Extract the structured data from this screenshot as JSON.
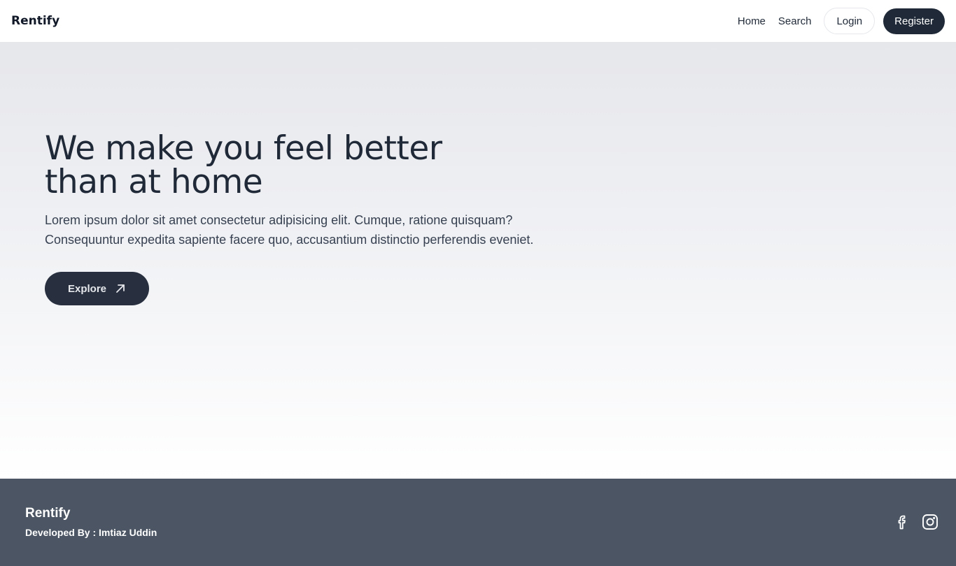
{
  "nav": {
    "brand": "Rentify",
    "links": [
      "Home",
      "Search"
    ],
    "login_label": "Login",
    "register_label": "Register"
  },
  "hero": {
    "title_line1": "We make you feel better",
    "title_line2": "than at home",
    "description_line1": "Lorem ipsum dolor sit amet consectetur adipisicing elit. Cumque, ratione quisquam?",
    "description_line2": "Consequuntur expedita sapiente facere quo, accusantium distinctio perferendis eveniet.",
    "explore_label": "Explore",
    "explore_icon": "arrow-up-right-icon"
  },
  "footer": {
    "brand": "Rentify",
    "credit": "Developed By : Imtiaz Uddin",
    "social_icons": [
      "facebook-icon",
      "instagram-icon"
    ]
  },
  "colors": {
    "primary_dark": "#1f2937",
    "button_dark": "#283040",
    "footer_bg": "#4b5563",
    "hero_top": "#e6e7eb"
  }
}
